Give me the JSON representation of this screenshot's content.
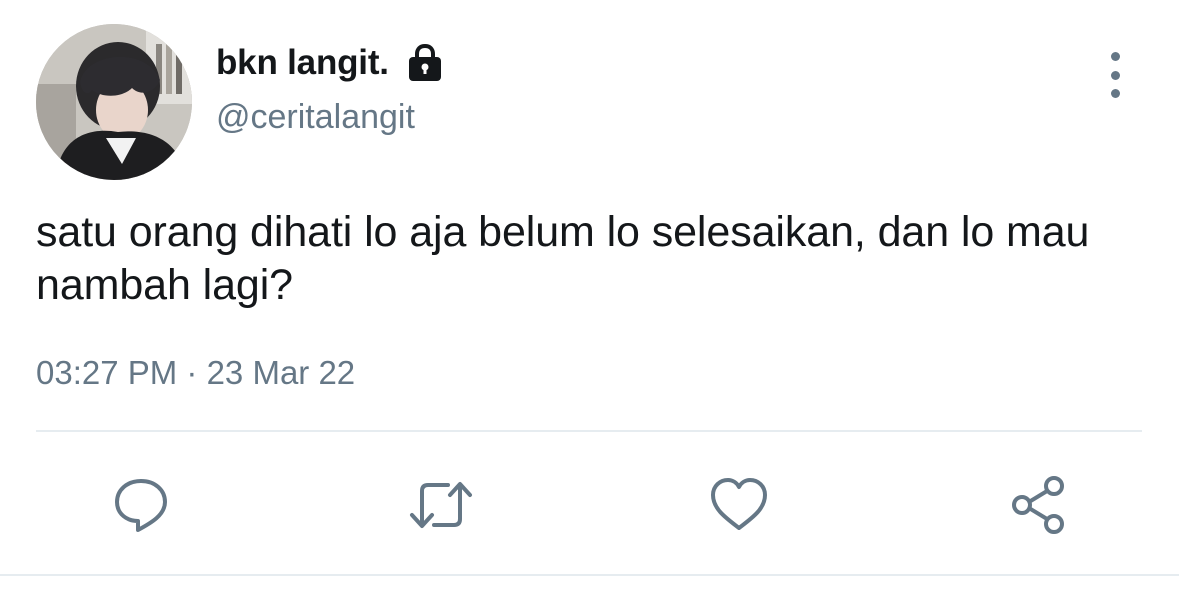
{
  "user": {
    "display_name": "bkn langit.",
    "handle": "@ceritalangit",
    "protected_icon": "lock-icon",
    "avatar": "avatar-photo"
  },
  "tweet": {
    "text": "satu orang dihati lo aja belum lo selesaikan, dan lo mau nambah lagi?",
    "timestamp": "03:27 PM · 23 Mar 22"
  },
  "menu": {
    "icon": "more-vertical-icon"
  },
  "actions": [
    {
      "name": "reply",
      "icon": "comment-icon"
    },
    {
      "name": "retweet",
      "icon": "retweet-icon"
    },
    {
      "name": "like",
      "icon": "heart-icon"
    },
    {
      "name": "share",
      "icon": "share-icon"
    }
  ],
  "colors": {
    "text_primary": "#14171a",
    "text_secondary": "#657786",
    "divider": "#e6ecf0",
    "background": "#ffffff"
  }
}
